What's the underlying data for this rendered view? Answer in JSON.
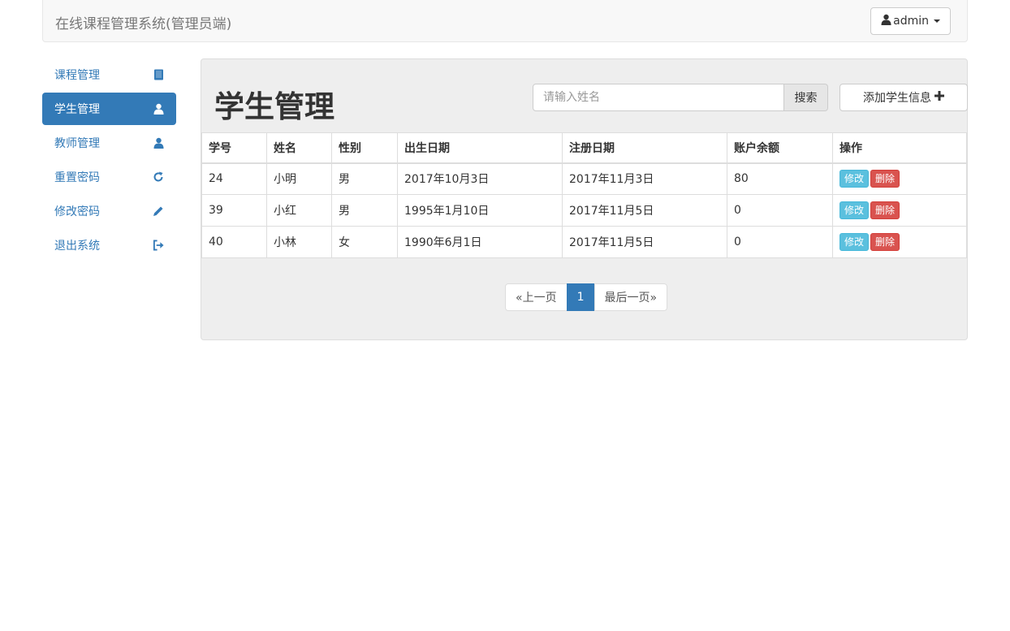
{
  "navbar": {
    "brand": "在线课程管理系统(管理员端)",
    "user": "admin"
  },
  "sidebar": {
    "items": [
      {
        "label": "课程管理",
        "icon": "book-icon",
        "active": false
      },
      {
        "label": "学生管理",
        "icon": "user-icon",
        "active": true
      },
      {
        "label": "教师管理",
        "icon": "user-icon",
        "active": false
      },
      {
        "label": "重置密码",
        "icon": "refresh-icon",
        "active": false
      },
      {
        "label": "修改密码",
        "icon": "pencil-icon",
        "active": false
      },
      {
        "label": "退出系统",
        "icon": "logout-icon",
        "active": false
      }
    ]
  },
  "main": {
    "title": "学生管理",
    "search": {
      "placeholder": "请输入姓名",
      "value": "",
      "button": "搜索"
    },
    "add_button": "添加学生信息",
    "table": {
      "headers": [
        "学号",
        "姓名",
        "性别",
        "出生日期",
        "注册日期",
        "账户余额",
        "操作"
      ],
      "rows": [
        [
          "24",
          "小明",
          "男",
          "2017年10月3日",
          "2017年11月3日",
          "80"
        ],
        [
          "39",
          "小红",
          "男",
          "1995年1月10日",
          "2017年11月5日",
          "0"
        ],
        [
          "40",
          "小林",
          "女",
          "1990年6月1日",
          "2017年11月5日",
          "0"
        ]
      ],
      "edit_label": "修改",
      "delete_label": "删除"
    },
    "pagination": {
      "prev": "«上一页",
      "current": "1",
      "last": "最后一页»"
    }
  },
  "colors": {
    "primary": "#337ab7",
    "info": "#5bc0de",
    "danger": "#d9534f"
  }
}
